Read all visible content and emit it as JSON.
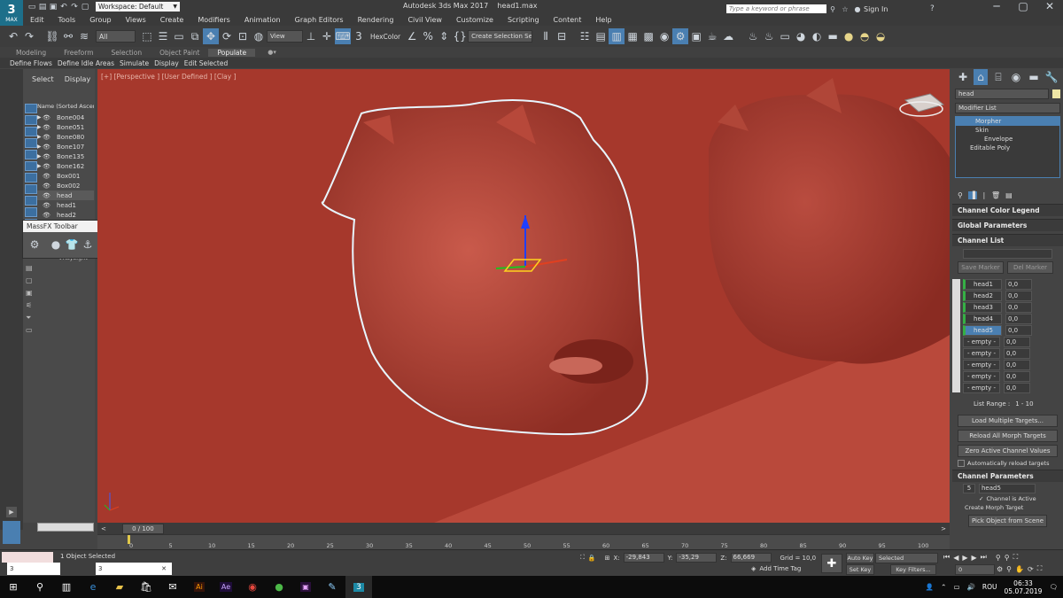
{
  "title_bar": {
    "workspace_label": "Workspace: Default",
    "app_title": "Autodesk 3ds Max 2017",
    "file_name": "head1.max",
    "search_placeholder": "Type a keyword or phrase",
    "sign_in": "Sign In"
  },
  "logo": {
    "big": "3",
    "small": "MAX"
  },
  "menu": [
    "Edit",
    "Tools",
    "Group",
    "Views",
    "Create",
    "Modifiers",
    "Animation",
    "Graph Editors",
    "Rendering",
    "Civil View",
    "Customize",
    "Scripting",
    "Content",
    "Help"
  ],
  "main_toolbar": {
    "selection_filter": "All",
    "view_dropdown": "View",
    "hexcolor": "HexColor",
    "named_selection": "Create Selection Se"
  },
  "ribbon_tabs": [
    "Modeling",
    "Freeform",
    "Selection",
    "Object Paint",
    "Populate"
  ],
  "ribbon_items": [
    "Define Flows",
    "Define Idle Areas",
    "Simulate",
    "Display",
    "Edit Selected"
  ],
  "explorer": {
    "tabs": [
      "Select",
      "Display"
    ],
    "header": "Name (Sorted Ascen",
    "items": [
      "Bone004",
      "Bone051",
      "Bone080",
      "Bone107",
      "Bone135",
      "Bone162",
      "Box001",
      "Box002",
      "head",
      "head1",
      "head2"
    ],
    "vraylight": "VRayLight"
  },
  "viewport": {
    "label": "[+] [Perspective ] [User Defined ] [Clay ]"
  },
  "massfx": {
    "title": "MassFX Toolbar"
  },
  "command_panel": {
    "name_field": "head",
    "modifier_list": "Modifier List",
    "stack": [
      "Morpher",
      "Skin",
      "Envelope",
      "Editable Poly"
    ],
    "rollouts": [
      "Channel Color Legend",
      "Global Parameters",
      "Channel List"
    ],
    "save_marker": "Save Marker",
    "del_marker": "Del Marker",
    "channels": [
      {
        "name": "head1",
        "value": "0,0"
      },
      {
        "name": "head2",
        "value": "0,0"
      },
      {
        "name": "head3",
        "value": "0,0"
      },
      {
        "name": "head4",
        "value": "0,0"
      },
      {
        "name": "head5",
        "value": "0,0"
      },
      {
        "name": "- empty -",
        "value": "0,0"
      },
      {
        "name": "- empty -",
        "value": "0,0"
      },
      {
        "name": "- empty -",
        "value": "0,0"
      },
      {
        "name": "- empty -",
        "value": "0,0"
      },
      {
        "name": "- empty -",
        "value": "0,0"
      }
    ],
    "list_range_label": "List Range :",
    "list_range_value": "1 - 10",
    "load_multiple": "Load Multiple Targets...",
    "reload_all": "Reload All Morph Targets",
    "zero_active": "Zero Active Channel Values",
    "auto_reload": "Automatically reload targets",
    "channel_params": "Channel Parameters",
    "channel_number": "5",
    "channel_name": "head5",
    "channel_active": "Channel is Active",
    "create_morph": "Create Morph Target",
    "pick_object": "Pick Object from Scene"
  },
  "timeline": {
    "frame_display": "0 / 100",
    "ticks": [
      "0",
      "5",
      "10",
      "15",
      "20",
      "25",
      "30",
      "35",
      "40",
      "45",
      "50",
      "55",
      "60",
      "65",
      "70",
      "75",
      "80",
      "85",
      "90",
      "95",
      "100"
    ]
  },
  "status": {
    "selection": "1 Object Selected",
    "x_label": "X:",
    "x_value": "-29,843",
    "y_label": "Y:",
    "y_value": "-35,29",
    "z_label": "Z:",
    "z_value": "66,669",
    "grid": "Grid = 10,0",
    "add_time_tag": "Add Time Tag",
    "auto_key": "Auto Key",
    "auto_key_mode": "Selected",
    "set_key": "Set Key",
    "key_filters": "Key Filters...",
    "frame": "0"
  },
  "taskbar": {
    "language": "ROU",
    "time": "06:33",
    "date": "05.07.2019"
  },
  "colors": {
    "viewport_bg": "#a6382c",
    "accent": "#4a7fb1",
    "channel_green": "#35b045"
  }
}
